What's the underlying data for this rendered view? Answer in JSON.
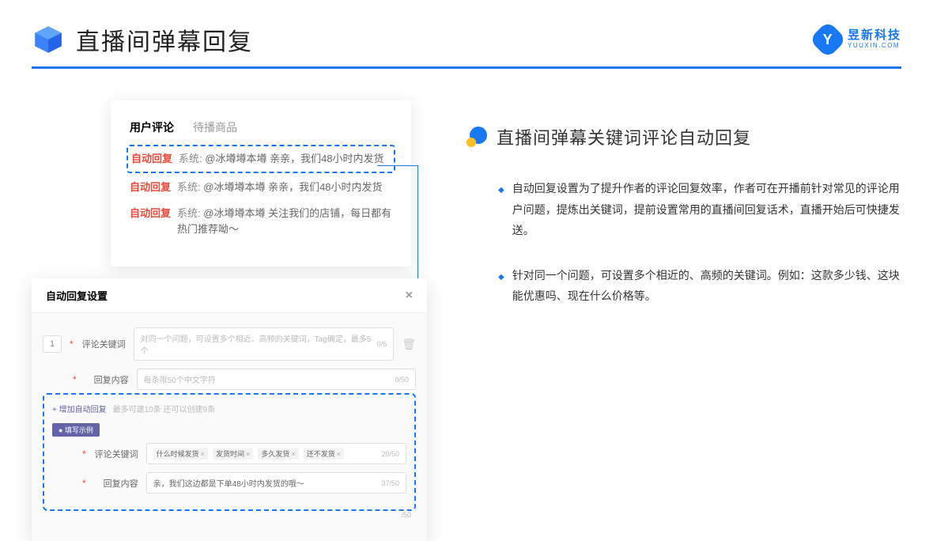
{
  "header": {
    "title": "直播间弹幕回复",
    "logo_cn": "昱新科技",
    "logo_en": "YUUXIN.COM",
    "logo_letter": "Y"
  },
  "comments_card": {
    "tab_active": "用户评论",
    "tab_inactive": "待播商品",
    "auto_label": "自动回复",
    "sys_label": "系统:",
    "c1": "@冰墫墫本墫 亲亲，我们48小时内发货",
    "c2": "@冰墫墫本墫 亲亲，我们48小时内发货",
    "c3": "@冰墫墫本墫 关注我们的店铺，每日都有热门推荐呦～"
  },
  "settings": {
    "title": "自动回复设置",
    "row_num": "1",
    "label_keyword": "评论关键词",
    "placeholder_keyword": "对同一个问题，可设置多个相近、高频的关键词，Tag确定，最多5个",
    "counter_kw": "0/6",
    "label_content": "回复内容",
    "placeholder_content": "每条限50个中文字符",
    "counter_ct": "0/50",
    "add_link": "+ 增加自动回复",
    "add_hint": "最多可建10条 还可以创建9条",
    "example_badge": "● 填写示例",
    "tag1": "什么时候发货",
    "tag2": "发货时间",
    "tag3": "多久发货",
    "tag4": "还不发货",
    "counter_ex_kw": "20/50",
    "example_reply": "亲，我们这边都是下单48小时内发货的哦～",
    "counter_ex_ct": "37/50",
    "counter_extra": "/50"
  },
  "right": {
    "section_title": "直播间弹幕关键词评论自动回复",
    "p1": "自动回复设置为了提升作者的评论回复效率，作者可在开播前针对常见的评论用户问题，提炼出关键词，提前设置常用的直播间回复话术，直播开始后可快捷发送。",
    "p2": "针对同一个问题，可设置多个相近的、高频的关键词。例如：这款多少钱、这块能优惠吗、现在什么价格等。"
  }
}
